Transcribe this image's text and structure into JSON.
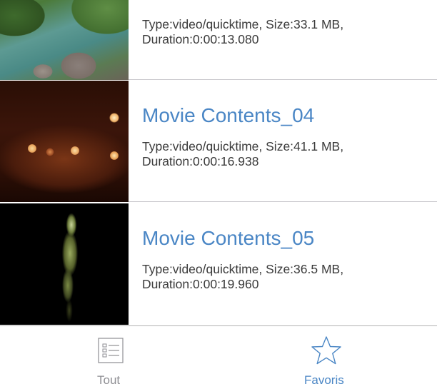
{
  "colors": {
    "title_blue": "#4a86c5",
    "meta_text": "#3a3a3a",
    "tab_inactive": "#8e8e93",
    "tab_active": "#4a86c5"
  },
  "list": {
    "items": [
      {
        "title": "",
        "meta": "Type:video/quicktime, Size:33.1 MB, Duration:0:00:13.080",
        "thumbnail": "river-forest-thumbnail"
      },
      {
        "title": "Movie Contents_04",
        "meta": "Type:video/quicktime, Size:41.1 MB, Duration:0:00:16.938",
        "thumbnail": "bokeh-lights-thumbnail"
      },
      {
        "title": "Movie Contents_05",
        "meta": "Type:video/quicktime, Size:36.5 MB, Duration:0:00:19.960",
        "thumbnail": "dark-figure-thumbnail"
      }
    ]
  },
  "tabbar": {
    "tabs": [
      {
        "label": "Tout",
        "icon": "list-icon",
        "active": false
      },
      {
        "label": "Favoris",
        "icon": "star-icon",
        "active": true
      }
    ]
  }
}
